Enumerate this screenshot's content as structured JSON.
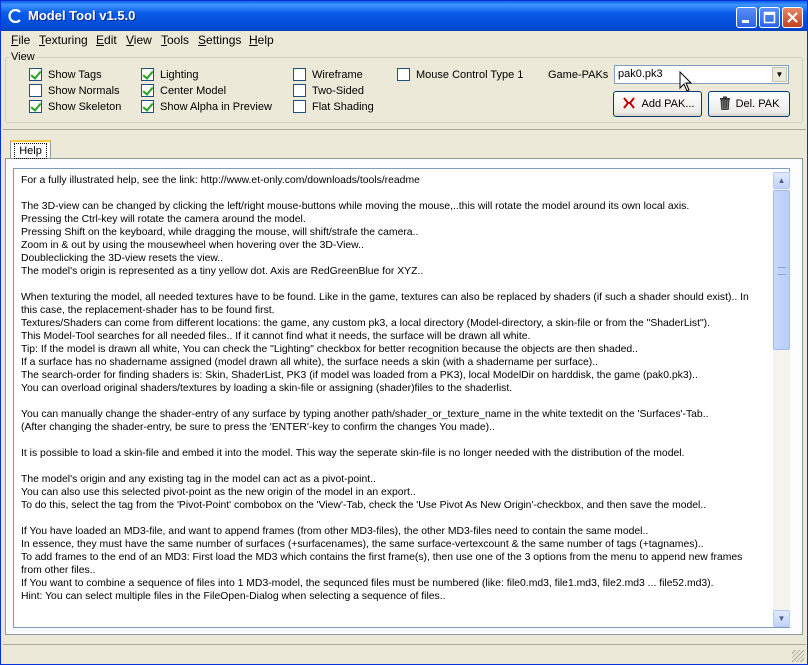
{
  "window": {
    "title": "Model Tool v1.5.0",
    "controls": {
      "minimize": "_",
      "maximize": "□",
      "close": "✕"
    }
  },
  "menu": [
    {
      "label": "File",
      "accel": "F",
      "rest": "ile"
    },
    {
      "label": "Texturing",
      "accel": "T",
      "rest": "exturing"
    },
    {
      "label": "Edit",
      "accel": "E",
      "rest": "dit"
    },
    {
      "label": "View",
      "accel": "V",
      "rest": "iew"
    },
    {
      "label": "Tools",
      "accel": "T",
      "rest": "ools"
    },
    {
      "label": "Settings",
      "accel": "S",
      "rest": "ettings"
    },
    {
      "label": "Help",
      "accel": "H",
      "rest": "elp"
    }
  ],
  "view_group": {
    "title": "View",
    "checkboxes": [
      {
        "label": "Show Tags",
        "checked": true
      },
      {
        "label": "Show Normals",
        "checked": false
      },
      {
        "label": "Show Skeleton",
        "checked": true
      },
      {
        "label": "Lighting",
        "checked": true
      },
      {
        "label": "Center Model",
        "checked": true
      },
      {
        "label": "Show Alpha in Preview",
        "checked": true
      },
      {
        "label": "Wireframe",
        "checked": false
      },
      {
        "label": "Two-Sided",
        "checked": false
      },
      {
        "label": "Flat Shading",
        "checked": false
      },
      {
        "label": "Mouse Control Type 1",
        "checked": false
      }
    ],
    "gamepaks_label": "Game-PAKs",
    "gamepaks_value": "pak0.pk3",
    "add_pak_label": "Add PAK...",
    "del_pak_label": "Del. PAK"
  },
  "tabs": [
    {
      "label": "Help"
    }
  ],
  "help_paragraphs": [
    [
      "For a fully illustrated help, see the link: http://www.et-only.com/downloads/tools/readme"
    ],
    [
      "The 3D-view can be changed by clicking the left/right mouse-buttons while moving the mouse,..this will rotate the model around its own local axis.",
      "Pressing the Ctrl-key will rotate the camera around the model.",
      "Pressing Shift on the keyboard, while dragging the mouse, will shift/strafe the camera..",
      "Zoom in & out by using the mousewheel when hovering over the 3D-View..",
      "Doubleclicking the 3D-view resets the view..",
      "The model's origin is represented as a tiny yellow dot. Axis are RedGreenBlue for XYZ.."
    ],
    [
      "When texturing the model, all needed textures have to be found. Like in the game, textures can also be replaced by shaders (if such a shader should exist).. In",
      "this case, the replacement-shader has to be found first.",
      "Textures/Shaders can come from different locations: the game, any custom pk3, a local directory (Model-directory, a skin-file or from the \"ShaderList\").",
      "This Model-Tool searches for all needed files.. If it cannot find what it needs, the surface will be drawn all white.",
      "Tip: If the model is drawn all white, You can check the \"Lighting\" checkbox for better recognition because the objects are then shaded..",
      "If a surface has no shadername assigned (model drawn all white), the surface needs a skin (with a shadername per surface)..",
      "The search-order for finding shaders is: Skin, ShaderList, PK3 (if model was loaded from a PK3), local ModelDir on harddisk, the game (pak0.pk3)..",
      "You can overload original shaders/textures by loading a skin-file or assigning (shader)files to the shaderlist."
    ],
    [
      "You can manually change the shader-entry of any surface by typing another path/shader_or_texture_name in the white textedit on the 'Surfaces'-Tab..",
      "(After changing the shader-entry, be sure to press the 'ENTER'-key to confirm the changes You made).."
    ],
    [
      "It is possible to load a skin-file and embed it into the model. This way the seperate skin-file is no longer needed with the distribution of the model."
    ],
    [
      "The model's origin and any existing tag in the model can act as a pivot-point..",
      "You can also use this selected pivot-point as the new origin of the model in an export..",
      "To do this, select the tag from the 'Pivot-Point' combobox on the 'View'-Tab, check the 'Use Pivot As New Origin'-checkbox, and then save the model.."
    ],
    [
      "If You have loaded an MD3-file, and want to append frames (from other MD3-files), the other MD3-files need to contain the same model..",
      "In essence, they must have the same number of surfaces (+surfacenames), the same surface-vertexcount & the same number of tags (+tagnames)..",
      "To add frames to the end of an MD3: First load the MD3 which contains the first frame(s), then use one of the 3 options from the menu to append new frames",
      "from other files..",
      "If You want to combine a sequence of files into 1 MD3-model, the sequnced files must be numbered (like: file0.md3, file1.md3, file2.md3 ... file52.md3).",
      "Hint: You can select multiple files in the FileOpen-Dialog when selecting a sequence of files.."
    ]
  ],
  "colors": {
    "titlebar": "#0a5ce8",
    "window_bg": "#ece9d8",
    "checkmark": "#21a121"
  }
}
